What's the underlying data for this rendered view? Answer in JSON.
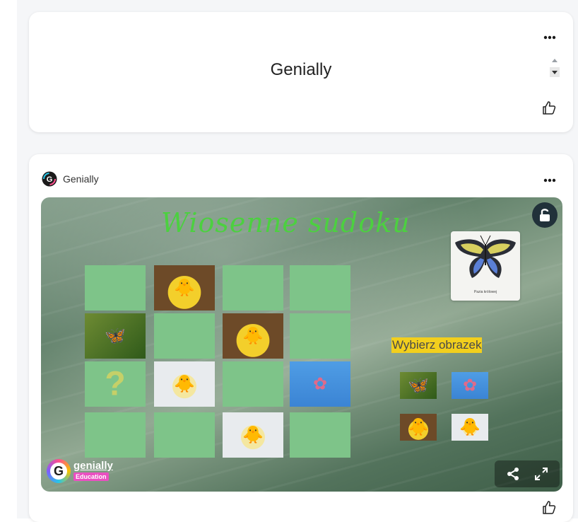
{
  "colors": {
    "accent_green": "#4cd040",
    "tile_green": "#7ec489",
    "label_yellow": "#f2cf1d"
  },
  "card_top": {
    "title": "Genially",
    "more_icon": "more-horizontal-icon",
    "like_icon": "thumbs-up-icon",
    "scroll_icons": [
      "arrow-up-icon",
      "arrow-down-icon"
    ]
  },
  "card_post": {
    "author": "Genially",
    "author_logo": "genially-logo-icon",
    "more_icon": "more-horizontal-icon",
    "like_icon": "thumbs-up-icon",
    "embed": {
      "title": "Wiosenne sudoku",
      "choose_label": "Wybierz obrazek",
      "preview_caption": "Pazia królowej",
      "badge_wordmark": "genially",
      "badge_tag": "Education",
      "lock_icon": "unlock-icon",
      "share_icon": "share-icon",
      "fullscreen_icon": "fullscreen-icon",
      "grid_tiles": [
        "empty",
        "chick-dark",
        "empty",
        "empty",
        "butterfly",
        "empty",
        "chick-dark",
        "empty",
        "question",
        "chick-light",
        "empty",
        "flower",
        "empty",
        "empty",
        "chick-light",
        "empty"
      ],
      "choices": [
        "butterfly",
        "flower",
        "chick-dark",
        "chick-light"
      ]
    }
  }
}
